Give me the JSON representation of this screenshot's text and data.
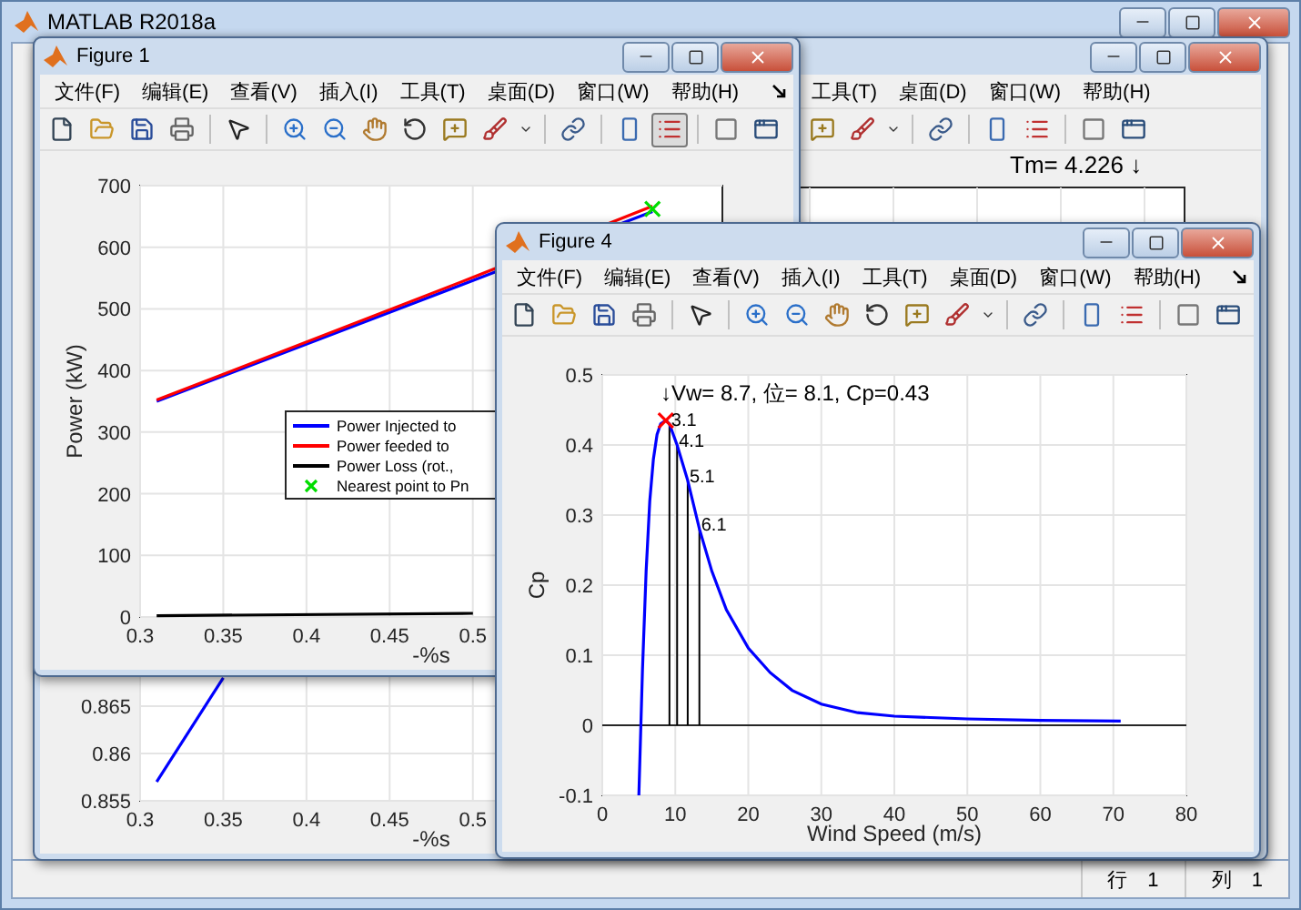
{
  "main_window": {
    "title": "MATLAB R2018a",
    "status": [
      "行 1",
      "列 1"
    ]
  },
  "figures": [
    {
      "kind": "back",
      "menu": [
        "工具(T)",
        "桌面(D)",
        "窗口(W)",
        "帮助(H)"
      ],
      "toolbar": {
        "legend_pressed": false
      },
      "readout": "Tm= 4.226 ↓",
      "chart_data": {
        "type": "line",
        "xlabel": "-%s",
        "x": [
          0.31,
          0.35
        ],
        "xlim": [
          0.3,
          0.65
        ],
        "ylim": [
          0.855,
          0.87
        ],
        "xticks": [
          0.3,
          0.35,
          0.4,
          0.45,
          0.5
        ],
        "yticks": [
          0.855,
          0.86,
          0.865
        ],
        "grid": true,
        "series": [
          {
            "color": "#0000ff",
            "values": [
              0.857,
              0.868
            ]
          }
        ]
      }
    },
    {
      "kind": "front",
      "title": "Figure 1",
      "menu": [
        "文件(F)",
        "编辑(E)",
        "查看(V)",
        "插入(I)",
        "工具(T)",
        "桌面(D)",
        "窗口(W)",
        "帮助(H)"
      ],
      "toolbar": {
        "legend_pressed": true
      },
      "chart_data": {
        "type": "line",
        "xlabel": "-%s",
        "ylabel": "Power (kW)",
        "x": [
          0.31,
          0.5,
          0.608
        ],
        "xlim": [
          0.3,
          0.65
        ],
        "ylim": [
          0,
          700
        ],
        "xticks": [
          0.3,
          0.35,
          0.4,
          0.45,
          0.5
        ],
        "yticks": [
          0,
          100,
          200,
          300,
          400,
          500,
          600,
          700
        ],
        "grid": true,
        "legend": true,
        "series": [
          {
            "name": "Power Injected to",
            "color": "#0000ff",
            "values": [
              350,
              546,
              658
            ]
          },
          {
            "name": "Power feeded to",
            "color": "#ff0000",
            "values": [
              352,
              551,
              667
            ]
          },
          {
            "name": "Power Loss (rot.,",
            "color": "#000000",
            "values": [
              2,
              6,
              null
            ]
          },
          {
            "name": "Nearest point to Pn",
            "color": "#00dd00",
            "marker": "x",
            "values": [
              null,
              null,
              662
            ]
          }
        ]
      }
    },
    {
      "kind": "front",
      "title": "Figure 4",
      "menu": [
        "文件(F)",
        "编辑(E)",
        "查看(V)",
        "插入(I)",
        "工具(T)",
        "桌面(D)",
        "窗口(W)",
        "帮助(H)"
      ],
      "toolbar": {
        "legend_pressed": false
      },
      "chart_data": {
        "type": "line",
        "xlabel": "Wind Speed (m/s)",
        "ylabel": "Cp",
        "x": [
          5.0,
          5.5,
          6,
          6.5,
          7,
          7.5,
          8,
          8.7,
          9.2,
          10.25,
          11.7,
          13.3,
          15,
          17,
          20,
          23,
          26,
          30,
          35,
          40,
          50,
          60,
          71
        ],
        "xlim": [
          0,
          80
        ],
        "ylim": [
          -0.1,
          0.5
        ],
        "xticks": [
          0,
          10,
          20,
          30,
          40,
          50,
          60,
          70,
          80
        ],
        "yticks": [
          -0.1,
          0,
          0.1,
          0.2,
          0.3,
          0.4,
          0.5
        ],
        "grid": true,
        "series": [
          {
            "color": "#0000ff",
            "values": [
              -0.1,
              0.08,
              0.22,
              0.32,
              0.38,
              0.415,
              0.43,
              0.435,
              0.43,
              0.4,
              0.35,
              0.28,
              0.22,
              0.165,
              0.11,
              0.075,
              0.05,
              0.03,
              0.018,
              0.013,
              0.009,
              0.007,
              0.006
            ]
          }
        ],
        "annotations": [
          "↓Vw= 8.7, 位= 8.1, Cp=0.43",
          {
            "x": 9.2,
            "y": 0.43,
            "text": "3.1"
          },
          {
            "x": 10.25,
            "y": 0.4,
            "text": "4.1"
          },
          {
            "x": 11.7,
            "y": 0.35,
            "text": "5.1"
          },
          {
            "x": 13.3,
            "y": 0.28,
            "text": "6.1"
          }
        ]
      }
    }
  ]
}
